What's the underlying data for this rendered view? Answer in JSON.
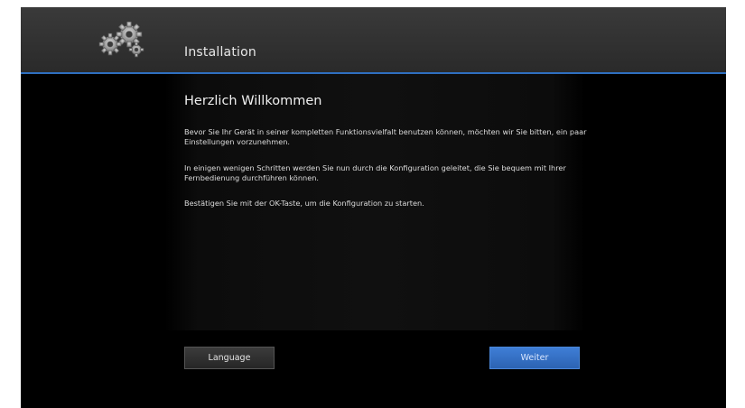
{
  "header": {
    "title": "Installation",
    "icon": "gears-icon"
  },
  "main": {
    "heading": "Herzlich Willkommen",
    "paragraphs": [
      "Bevor Sie Ihr Gerät in seiner kompletten Funktionsvielfalt benutzen können, möchten wir Sie bitten, ein paar Einstellungen vorzunehmen.",
      "In einigen wenigen Schritten werden Sie nun durch die Konfiguration geleitet, die Sie bequem mit Ihrer Fernbedienung durchführen können.",
      "Bestätigen Sie mit der OK-Taste, um die Konfiguration zu starten."
    ]
  },
  "buttons": {
    "language": "Language",
    "next": "Weiter"
  },
  "colors": {
    "accent": "#2f6fc0",
    "background": "#000000",
    "header": "#333333"
  }
}
